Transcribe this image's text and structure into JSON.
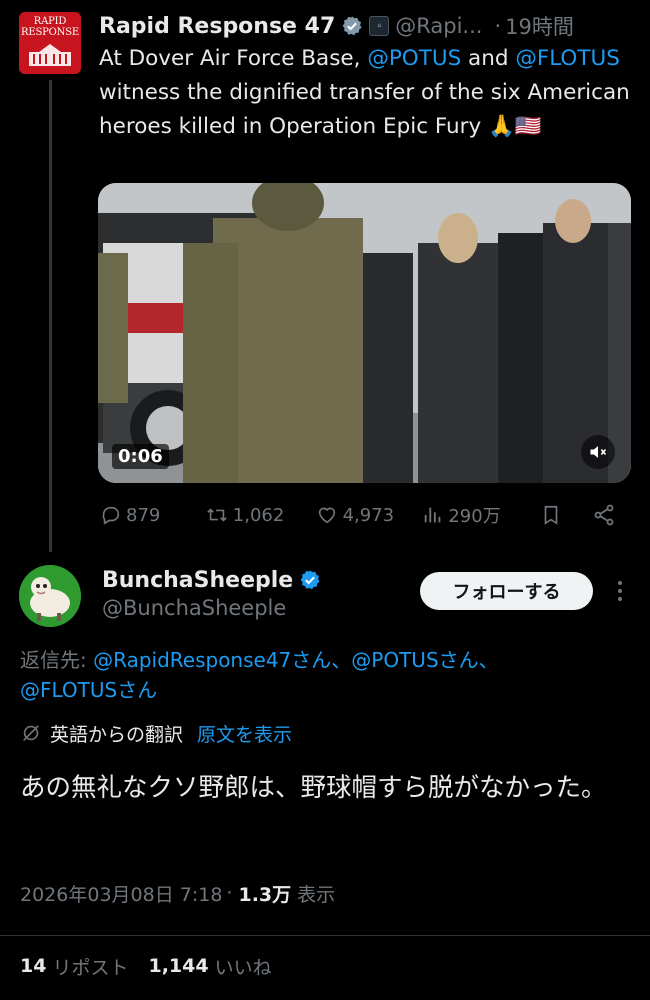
{
  "tweet1": {
    "avatar_text": "RAPID\nRESPONSE",
    "display_name": "Rapid Response 47",
    "gov_badge_text": "WHITE HOUSE",
    "handle": "@Rapi...",
    "time_sep": "·",
    "time": "19時間",
    "text_segments": [
      {
        "t": "At Dover Air Force Base, ",
        "m": false
      },
      {
        "t": "@POTUS",
        "m": true
      },
      {
        "t": " and ",
        "m": false
      },
      {
        "t": "@FLOTUS",
        "m": true
      },
      {
        "t": " witness the dignified transfer of the six American heroes killed in Operation Epic Fury 🙏🇺🇸",
        "m": false
      }
    ],
    "video_duration": "0:06",
    "replies": "879",
    "reposts": "1,062",
    "likes": "4,973",
    "views": "290万"
  },
  "tweet2": {
    "display_name": "BunchaSheeple",
    "handle": "@BunchaSheeple",
    "follow_label": "フォローする",
    "reply_prefix": "返信先: ",
    "reply_mentions": [
      "@RapidResponse47さん",
      "@POTUSさん",
      "@FLOTUSさん"
    ],
    "translation_label": "英語からの翻訳",
    "show_original": "原文を表示",
    "text": "あの無礼なクソ野郎は、野球帽すら脱がなかった。",
    "timestamp": "2026年03月08日 7:18",
    "meta_sep": "·",
    "views_count": "1.3万",
    "views_label": "表示",
    "reposts_count": "14",
    "reposts_label": "リポスト",
    "likes_count": "1,144",
    "likes_label": "いいね"
  },
  "colors": {
    "background": "#000000",
    "text": "#e7e9ea",
    "muted": "#71767b",
    "link": "#1d9bf0",
    "avatar_red": "#c8141e",
    "follow_bg": "#eff3f4"
  },
  "icons": [
    "verified-gray-icon",
    "gov-badge-icon",
    "mute-icon",
    "reply-icon",
    "repost-icon",
    "like-icon",
    "views-icon",
    "bookmark-icon",
    "share-icon",
    "verified-blue-icon",
    "more-icon",
    "translate-icon"
  ]
}
